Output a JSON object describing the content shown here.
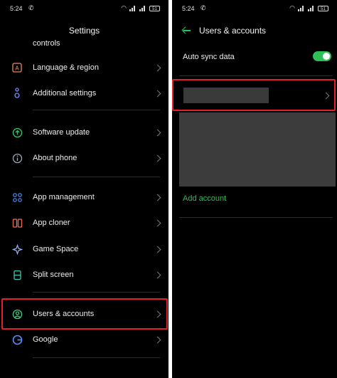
{
  "left": {
    "status": {
      "time": "5:24",
      "battery": "51"
    },
    "title": "Settings",
    "items": [
      {
        "label": "controls"
      },
      {
        "label": "Language & region"
      },
      {
        "label": "Additional settings"
      },
      {
        "label": "Software update"
      },
      {
        "label": "About phone"
      },
      {
        "label": "App management"
      },
      {
        "label": "App cloner"
      },
      {
        "label": "Game Space"
      },
      {
        "label": "Split screen"
      },
      {
        "label": "Users & accounts"
      },
      {
        "label": "Google"
      }
    ]
  },
  "right": {
    "status": {
      "time": "5:24",
      "battery": "51"
    },
    "title": "Users & accounts",
    "auto_sync_label": "Auto sync data",
    "auto_sync_on": true,
    "add_account_label": "Add account"
  },
  "colors": {
    "accent": "#2fbf57",
    "highlight": "#e0202a",
    "background": "#000000"
  }
}
